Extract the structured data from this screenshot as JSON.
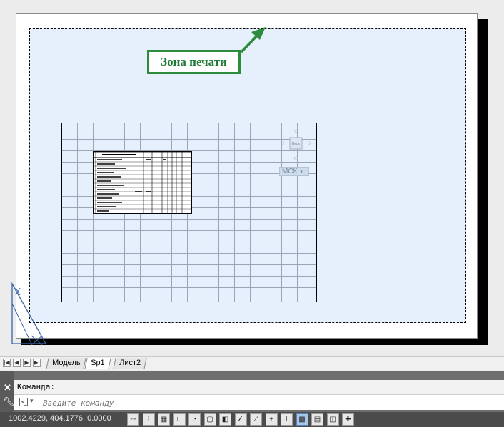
{
  "callout": {
    "text": "Зона печати"
  },
  "viewcube": {
    "top": "С",
    "bottom": "Ю",
    "left": "З",
    "right": "В",
    "face": "Верх"
  },
  "mck": {
    "label": "МСК"
  },
  "tabs": [
    {
      "label": "Модель",
      "active": false
    },
    {
      "label": "Sp1",
      "active": true
    },
    {
      "label": "Лист2",
      "active": false
    }
  ],
  "command": {
    "history_text": "Команда:",
    "input_placeholder": "Введите команду"
  },
  "status": {
    "coordinates": "1002.4229, 404.1776, 0.0000",
    "tools": [
      {
        "icon": "infer-constraints-icon",
        "glyph": "⊹",
        "on": false
      },
      {
        "icon": "snap-mode-icon",
        "glyph": "⁞",
        "on": false
      },
      {
        "icon": "grid-display-icon",
        "glyph": "▦",
        "on": false
      },
      {
        "icon": "ortho-mode-icon",
        "glyph": "∟",
        "on": false
      },
      {
        "icon": "polar-tracking-icon",
        "glyph": "◔",
        "on": false
      },
      {
        "icon": "object-snap-icon",
        "glyph": "▢",
        "on": false
      },
      {
        "icon": "3d-object-snap-icon",
        "glyph": "◧",
        "on": false
      },
      {
        "icon": "object-snap-tracking-icon",
        "glyph": "∠",
        "on": false
      },
      {
        "icon": "dynamic-ucs-icon",
        "glyph": "⟋",
        "on": false
      },
      {
        "icon": "dynamic-input-icon",
        "glyph": "+",
        "on": false
      },
      {
        "icon": "lineweight-icon",
        "glyph": "⊥",
        "on": false
      },
      {
        "icon": "transparency-icon",
        "glyph": "▩",
        "on": true
      },
      {
        "icon": "quick-properties-icon",
        "glyph": "▤",
        "on": false
      },
      {
        "icon": "selection-cycling-icon",
        "glyph": "◫",
        "on": false
      },
      {
        "icon": "annotation-monitor-icon",
        "glyph": "✚",
        "on": false
      }
    ]
  }
}
